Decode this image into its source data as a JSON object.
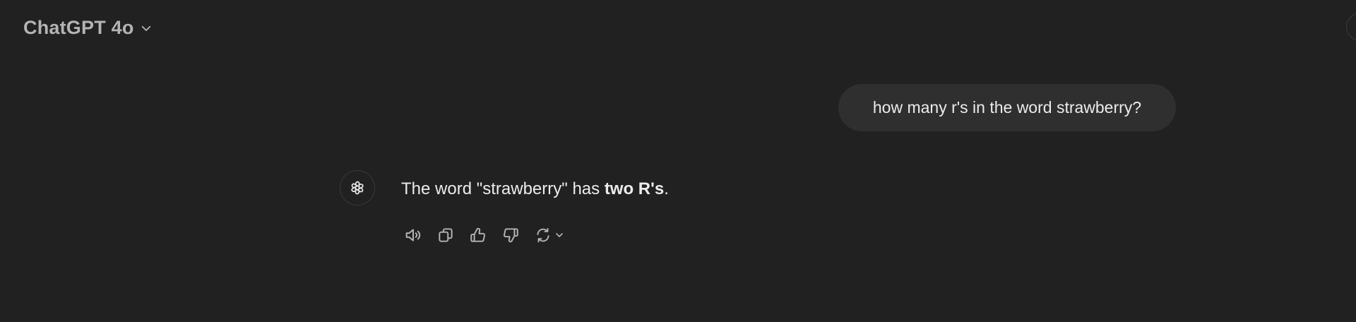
{
  "header": {
    "model_title": "ChatGPT 4o",
    "model_chevron_icon": "chevron-down-icon"
  },
  "conversation": {
    "user_message": {
      "text": "how many r's in the word strawberry?"
    },
    "assistant_message": {
      "avatar_icon": "openai-logo-icon",
      "text_before": "The word \"strawberry\" has ",
      "text_bold": "two R's",
      "text_after": "."
    },
    "actions": [
      {
        "name": "read-aloud",
        "icon": "speaker-icon"
      },
      {
        "name": "copy",
        "icon": "copy-icon"
      },
      {
        "name": "good-response",
        "icon": "thumbs-up-icon"
      },
      {
        "name": "bad-response",
        "icon": "thumbs-down-icon"
      },
      {
        "name": "regenerate",
        "icon": "refresh-icon"
      }
    ]
  },
  "colors": {
    "background": "#212121",
    "user_bubble": "#2f2f2f",
    "text": "#ececec",
    "muted": "#b4b4b4"
  }
}
